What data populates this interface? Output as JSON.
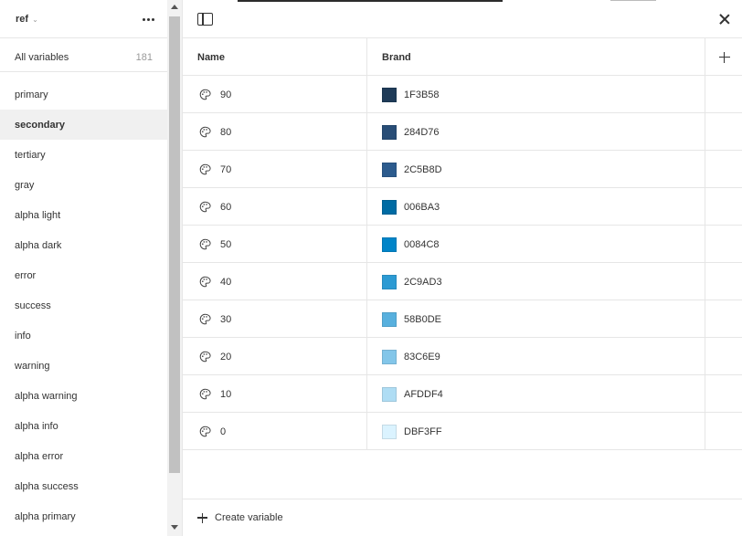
{
  "sidebar": {
    "collection_name": "ref",
    "all_variables_label": "All variables",
    "all_variables_count": "181",
    "groups": [
      {
        "label": "primary"
      },
      {
        "label": "secondary"
      },
      {
        "label": "tertiary"
      },
      {
        "label": "gray"
      },
      {
        "label": "alpha light"
      },
      {
        "label": "alpha dark"
      },
      {
        "label": "error"
      },
      {
        "label": "success"
      },
      {
        "label": "info"
      },
      {
        "label": "warning"
      },
      {
        "label": "alpha warning"
      },
      {
        "label": "alpha info"
      },
      {
        "label": "alpha error"
      },
      {
        "label": "alpha success"
      },
      {
        "label": "alpha primary"
      }
    ],
    "active_group": "secondary"
  },
  "table": {
    "name_header": "Name",
    "mode_header": "Brand",
    "rows": [
      {
        "name": "90",
        "hex": "1F3B58",
        "color": "#1F3B58"
      },
      {
        "name": "80",
        "hex": "284D76",
        "color": "#284D76"
      },
      {
        "name": "70",
        "hex": "2C5B8D",
        "color": "#2C5B8D"
      },
      {
        "name": "60",
        "hex": "006BA3",
        "color": "#006BA3"
      },
      {
        "name": "50",
        "hex": "0084C8",
        "color": "#0084C8"
      },
      {
        "name": "40",
        "hex": "2C9AD3",
        "color": "#2C9AD3"
      },
      {
        "name": "30",
        "hex": "58B0DE",
        "color": "#58B0DE"
      },
      {
        "name": "20",
        "hex": "83C6E9",
        "color": "#83C6E9"
      },
      {
        "name": "10",
        "hex": "AFDDF4",
        "color": "#AFDDF4"
      },
      {
        "name": "0",
        "hex": "DBF3FF",
        "color": "#DBF3FF"
      }
    ]
  },
  "footer": {
    "create_label": "Create variable"
  },
  "icons": {
    "variable": "palette-icon",
    "add_mode": "plus-icon",
    "close": "close-icon",
    "panel": "sidebar-toggle-icon",
    "more": "more-icon"
  }
}
